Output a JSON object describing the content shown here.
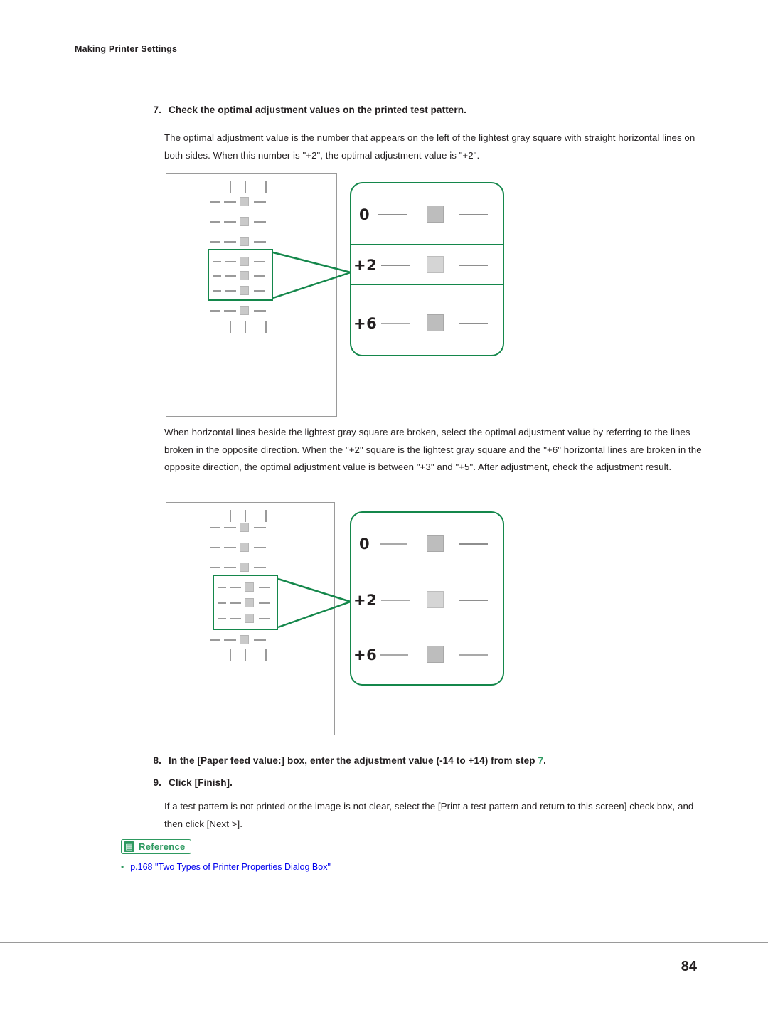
{
  "header": {
    "title": "Making Printer Settings"
  },
  "footer": {
    "page_number": "84"
  },
  "steps": [
    {
      "number": "7.",
      "text": "Check the optimal adjustment values on the printed test pattern."
    },
    {
      "number": "8.",
      "text_before": "In the [Paper feed value:] box, enter the adjustment value (-14 to +14) from step ",
      "link": "7",
      "text_after": "."
    },
    {
      "number": "9.",
      "text": "Click [Finish]."
    }
  ],
  "paragraphs": {
    "p1": "The optimal adjustment value is the number that appears on the left of the lightest gray square with straight horizontal lines on both sides. When this number is \"+2\", the optimal adjustment value is \"+2\".",
    "p2": "When horizontal lines beside the lightest gray square are broken, select the optimal adjustment value by referring to the lines broken in the opposite direction. When the \"+2\" square is the lightest gray square and the \"+6\" horizontal lines are broken in the opposite direction, the optimal adjustment value is between \"+3\" and \"+5\". After adjustment, check the adjustment result.",
    "p3": "If a test pattern is not printed or the image is not clear, select the [Print a test pattern and return to this screen] check box, and then click [Next >]."
  },
  "reference": {
    "badge_icon": "book-icon",
    "badge_glyph": "▤",
    "badge_label": "Reference",
    "bullet": "•",
    "item": "p.168 \"Two Types of Printer Properties Dialog Box\""
  },
  "figures": [
    {
      "name": "test-pattern-figure-1",
      "callout_rows": [
        {
          "label": "0"
        },
        {
          "label": "+2"
        },
        {
          "label": "+6"
        }
      ],
      "highlighted_row": "+2"
    },
    {
      "name": "test-pattern-figure-2",
      "callout_rows": [
        {
          "label": "0"
        },
        {
          "label": "+2"
        },
        {
          "label": "+6"
        }
      ],
      "highlighted_row": "+2"
    }
  ]
}
